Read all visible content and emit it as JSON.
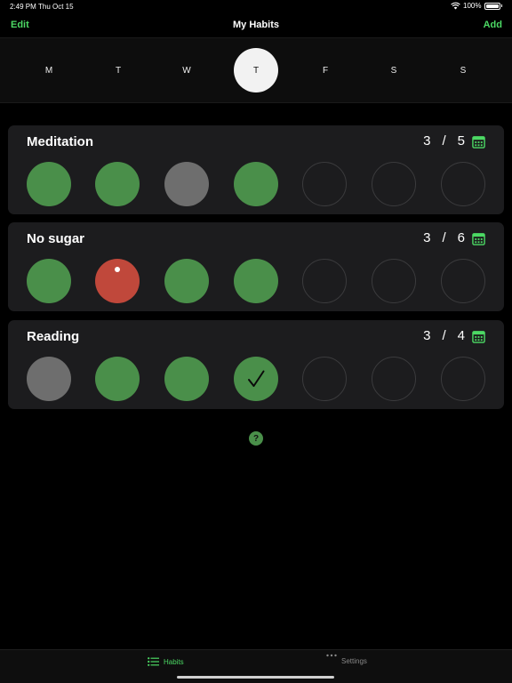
{
  "status": {
    "time": "2:49 PM",
    "date": "Thu Oct 15",
    "battery": "100%"
  },
  "nav": {
    "left": "Edit",
    "title": "My Habits",
    "right": "Add"
  },
  "week": {
    "days": [
      "M",
      "T",
      "W",
      "T",
      "F",
      "S",
      "S"
    ],
    "selected_index": 3
  },
  "habits": [
    {
      "name": "Meditation",
      "done": "3",
      "sep": "/",
      "goal": "5",
      "days": [
        "done",
        "done",
        "skip",
        "done",
        "empty",
        "empty",
        "empty"
      ]
    },
    {
      "name": "No sugar",
      "done": "3",
      "sep": "/",
      "goal": "6",
      "days": [
        "done",
        "fail",
        "done",
        "done",
        "empty",
        "empty",
        "empty"
      ]
    },
    {
      "name": "Reading",
      "done": "3",
      "sep": "/",
      "goal": "4",
      "days": [
        "skip",
        "done",
        "done",
        "checked",
        "empty",
        "empty",
        "empty"
      ]
    }
  ],
  "help": {
    "label": "?"
  },
  "tabs": [
    {
      "label": "Habits",
      "icon": "list-icon",
      "active": true
    },
    {
      "label": "Settings",
      "icon": "more-icon",
      "active": false
    }
  ],
  "colors": {
    "accent": "#4cd964",
    "done": "#4a8f4a",
    "skip": "#6e6e6e",
    "fail": "#c0483b"
  }
}
